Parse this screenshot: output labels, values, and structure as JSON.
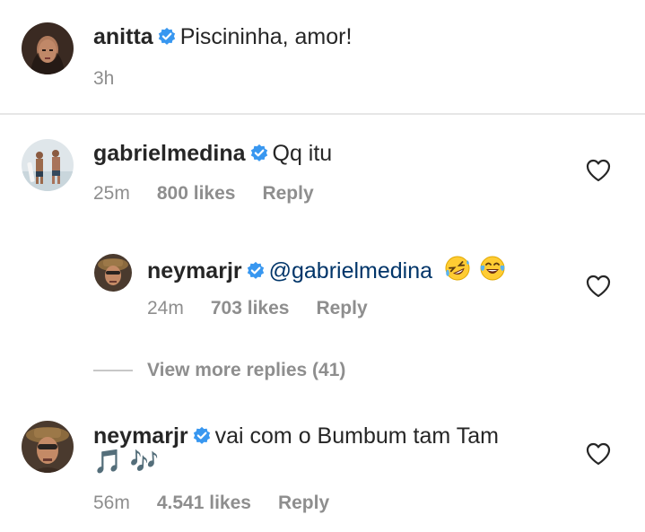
{
  "post": {
    "username": "anitta",
    "caption": "Piscininha, amor!",
    "time": "3h"
  },
  "comments": [
    {
      "username": "gabrielmedina",
      "text": "Qq itu",
      "time": "25m",
      "likes": "800 likes",
      "reply": "Reply"
    },
    {
      "username": "neymarjr",
      "mention": "@gabrielmedina",
      "emoji": [
        "rofl",
        "joy"
      ],
      "time": "24m",
      "likes": "703 likes",
      "reply": "Reply"
    },
    {
      "username": "neymarjr",
      "text": "vai com o Bumbum tam Tam",
      "text_line2": "🎵 🎶",
      "time": "56m",
      "likes": "4.541 likes",
      "reply": "Reply"
    }
  ],
  "view_more": "View more replies (41)",
  "icons": {
    "verified": "verified-badge-icon",
    "like": "heart-outline-icon"
  },
  "colors": {
    "verified": "#3897f0",
    "mention": "#003569",
    "meta": "#8e8e8e"
  }
}
